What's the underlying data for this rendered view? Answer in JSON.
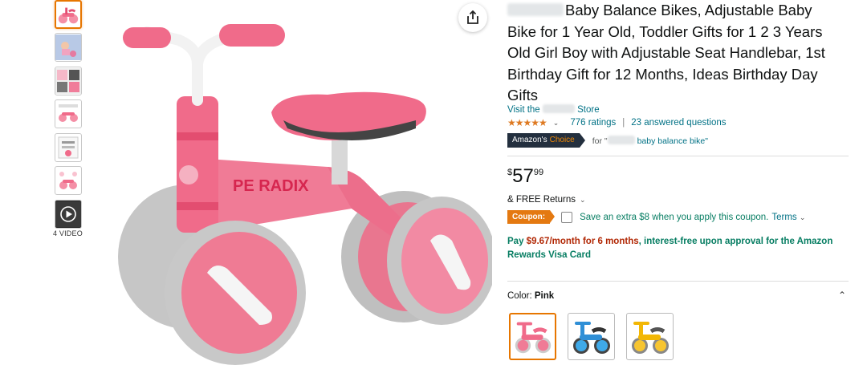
{
  "product": {
    "title": "Baby Balance Bikes, Adjustable Baby Bike for 1 Year Old, Toddler Gifts for 1 2 3 Years Old Girl Boy with Adjustable Seat Handlebar, 1st Birthday Gift for 12 Months, Ideas Birthday Day Gifts",
    "brand_logo_text": "PE RADIX"
  },
  "store": {
    "prefix": "Visit the",
    "suffix": "Store"
  },
  "rating": {
    "stars": "★★★★★",
    "ratings_label": "776 ratings",
    "separator": "|",
    "questions_label": "23 answered questions"
  },
  "badge": {
    "amazons": "Amazon's",
    "choice": "Choice",
    "for_prefix": "for \"",
    "keyword": "baby balance bike\""
  },
  "price": {
    "currency": "$",
    "whole": "57",
    "fraction": "99"
  },
  "returns": {
    "label": "& FREE Returns"
  },
  "coupon": {
    "tag": "Coupon:",
    "text": "Save an extra $8 when you apply this coupon.",
    "terms": "Terms"
  },
  "payment": {
    "prefix": "Pay",
    "amount": "$9.67/month for 6 months",
    "suffix": ", interest-free upon approval for the Amazon Rewards Visa Card"
  },
  "color": {
    "label": "Color:",
    "selected": "Pink",
    "options": [
      "Pink",
      "Blue",
      "Yellow"
    ]
  },
  "media": {
    "video_label": "4 VIDEO"
  },
  "icons": {
    "share": "share-icon",
    "collapse": "chevron-up-icon",
    "chevron": "chevron-down-icon",
    "play": "play-icon"
  },
  "colors": {
    "link": "#007185",
    "price_red": "#b12704",
    "green": "#067d62",
    "accent_orange": "#e77600",
    "star": "#de7921"
  }
}
